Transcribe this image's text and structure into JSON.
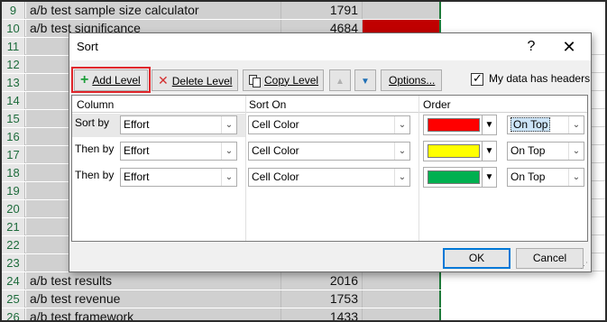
{
  "sheet": {
    "rows": [
      {
        "num": "9",
        "text": "a/b test sample size calculator",
        "value": "1791",
        "color": "#d0d0d0"
      },
      {
        "num": "10",
        "text": "a/b test significance",
        "value": "4684",
        "color": "#c00000"
      },
      {
        "num": "11",
        "text": "",
        "value": "",
        "color": "#d0d0d0"
      },
      {
        "num": "12",
        "text": "",
        "value": "",
        "color": "#d0d0d0"
      },
      {
        "num": "13",
        "text": "",
        "value": "",
        "color": "#d0d0d0"
      },
      {
        "num": "14",
        "text": "",
        "value": "",
        "color": "#d0d0d0"
      },
      {
        "num": "15",
        "text": "",
        "value": "",
        "color": "#d0d0d0"
      },
      {
        "num": "16",
        "text": "",
        "value": "",
        "color": "#d0d0d0"
      },
      {
        "num": "17",
        "text": "",
        "value": "",
        "color": "#d0d0d0"
      },
      {
        "num": "18",
        "text": "",
        "value": "",
        "color": "#d0d0d0"
      },
      {
        "num": "19",
        "text": "",
        "value": "",
        "color": "#d0d0d0"
      },
      {
        "num": "20",
        "text": "",
        "value": "",
        "color": "#d0d0d0"
      },
      {
        "num": "21",
        "text": "",
        "value": "",
        "color": "#d0d0d0"
      },
      {
        "num": "22",
        "text": "",
        "value": "",
        "color": "#d0d0d0"
      },
      {
        "num": "23",
        "text": "",
        "value": "",
        "color": "#d0d0d0"
      },
      {
        "num": "24",
        "text": "a/b test results",
        "value": "2016",
        "color": "#d0d0d0"
      },
      {
        "num": "25",
        "text": "a/b test revenue",
        "value": "1753",
        "color": "#d0d0d0"
      },
      {
        "num": "26",
        "text": "a/b test framework",
        "value": "1433",
        "color": "#d0d0d0"
      }
    ]
  },
  "dialog": {
    "title": "Sort",
    "help": "?",
    "close": "✕",
    "toolbar": {
      "add_icon": "+",
      "add_label": "Add Level",
      "delete_icon": "✕",
      "delete_label": "Delete Level",
      "copy_label": "Copy Level",
      "up_icon": "▲",
      "down_icon": "▼",
      "options_label": "Options..."
    },
    "headers_checkbox": {
      "checked": true,
      "mark": "✓",
      "label": "My data has headers"
    },
    "columns": {
      "column": "Column",
      "sort_on": "Sort On",
      "order": "Order"
    },
    "levels": [
      {
        "label": "Sort by",
        "column": "Effort",
        "sort_on": "Cell Color",
        "color": "#ff0000",
        "position": "On Top"
      },
      {
        "label": "Then by",
        "column": "Effort",
        "sort_on": "Cell Color",
        "color": "#ffff00",
        "position": "On Top"
      },
      {
        "label": "Then by",
        "column": "Effort",
        "sort_on": "Cell Color",
        "color": "#00b050",
        "position": "On Top"
      }
    ],
    "ok_label": "OK",
    "cancel_label": "Cancel",
    "dropdown_icon": "⌄",
    "arrow_icon": "▼"
  }
}
